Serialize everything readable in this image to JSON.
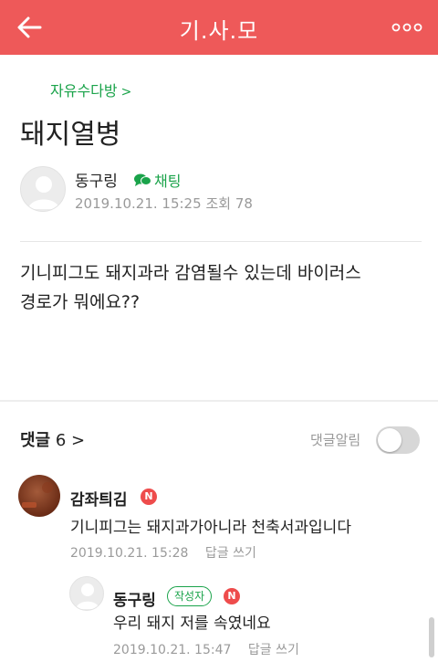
{
  "app_bar": {
    "title": "기.사.모",
    "back_icon": "back-arrow-icon",
    "more_icon": "more-dots-icon",
    "color": "#ee5959"
  },
  "post": {
    "board": "자유수다방",
    "board_chevron": ">",
    "title": "돼지열병",
    "author": {
      "name": "동구링",
      "chat_label": "채팅",
      "date": "2019.10.21. 15:25",
      "views_label": "조회",
      "views": "78"
    },
    "body_line1": "기니피그도 돼지과라 감염될수 있는데 바이러스",
    "body_line2": "경로가 뭐에요??"
  },
  "comments": {
    "label": "댓글",
    "count": "6",
    "chevron": ">",
    "notify_label": "댓글알림",
    "notify_on": false,
    "items": [
      {
        "name": "감좌틔김",
        "badge": "N",
        "text": "기니피그는 돼지과가아니라 천축서과입니다",
        "date": "2019.10.21. 15:28",
        "reply_label": "답글 쓰기"
      },
      {
        "name": "동구링",
        "author_tag": "작성자",
        "badge": "N",
        "text": "우리 돼지 저를 속였네요",
        "date": "2019.10.21. 15:47",
        "reply_label": "답글 쓰기"
      }
    ]
  },
  "colors": {
    "accent_green": "#1aa34a",
    "badge_red": "#ee4c4c"
  }
}
